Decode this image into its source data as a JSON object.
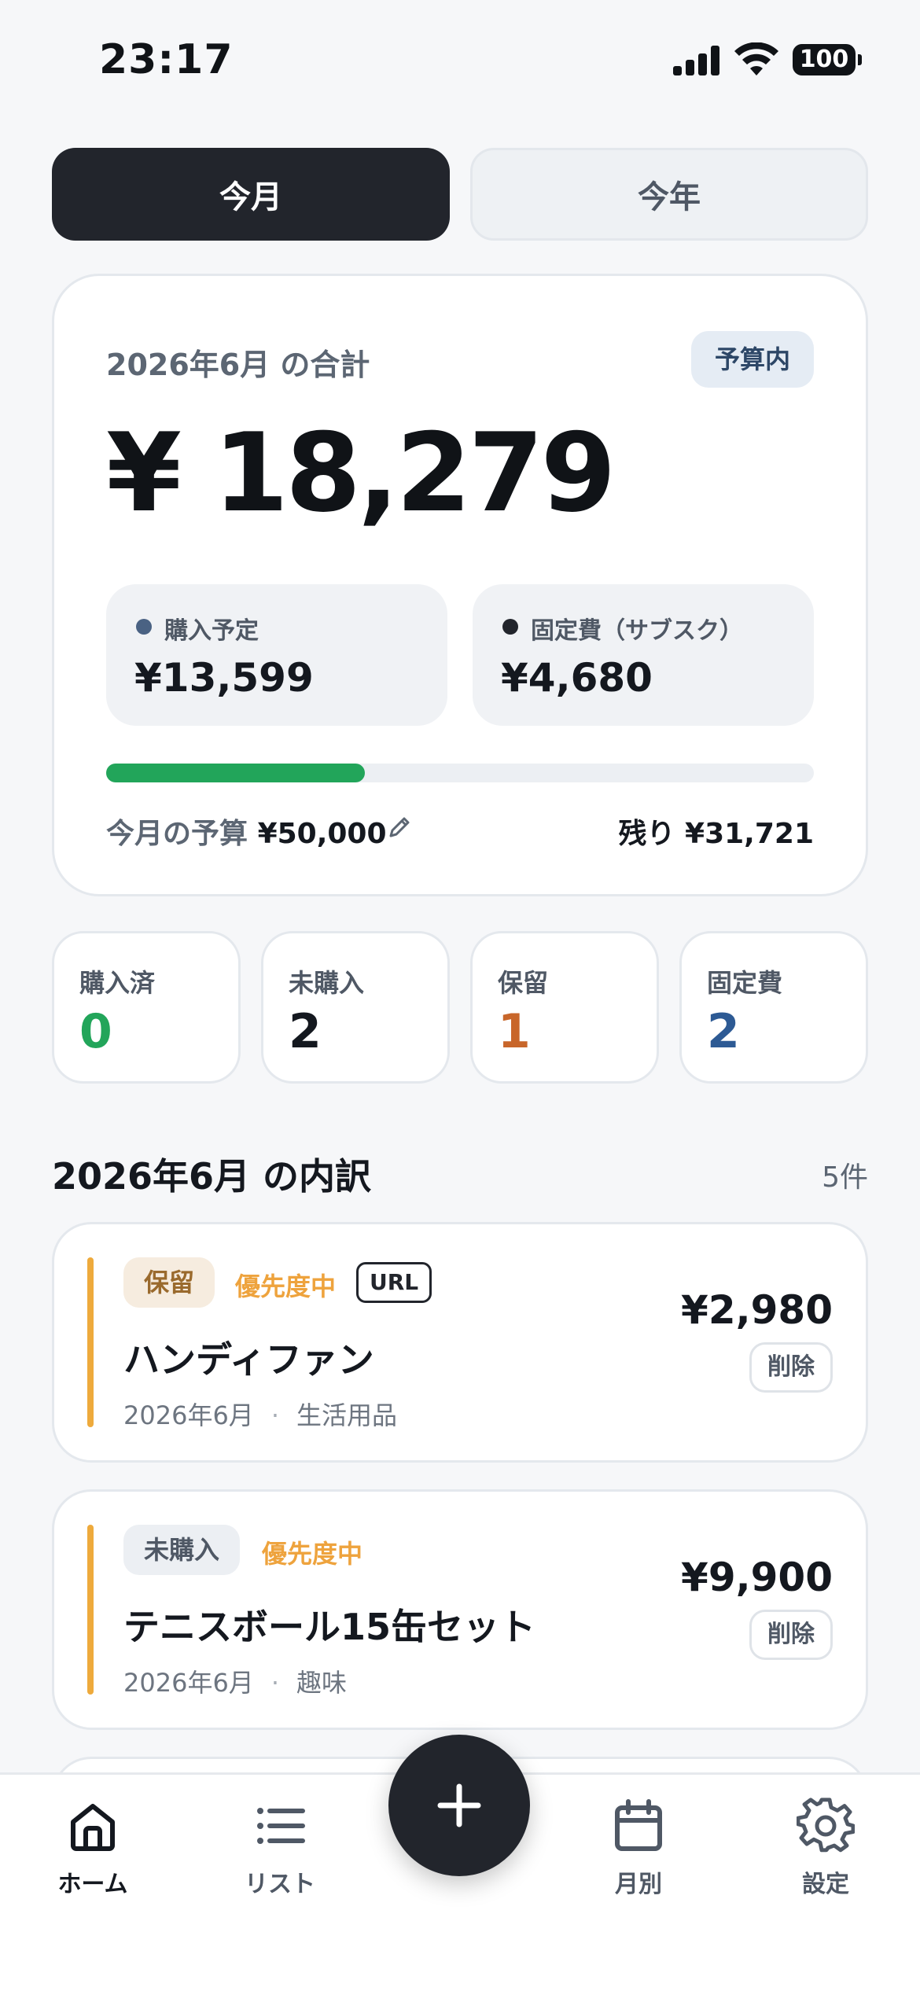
{
  "status_bar": {
    "time": "23:17",
    "battery": "100"
  },
  "segment": {
    "month": "今月",
    "year": "今年"
  },
  "summary": {
    "label": "2026年6月 の合計",
    "badge": "予算内",
    "total": "¥ 18,279",
    "planned": {
      "label": "購入予定",
      "value": "¥13,599",
      "dot_color": "#4a6283"
    },
    "fixed": {
      "label": "固定費（サブスク）",
      "value": "¥4,680",
      "dot_color": "#22252c"
    },
    "progress_fraction": 0.366,
    "progress_color": "#22a55a",
    "budget_label": "今月の予算",
    "budget_value": "¥50,000",
    "remaining": "残り ¥31,721"
  },
  "stats": [
    {
      "label": "購入済",
      "value": "0",
      "color": "#22a55a"
    },
    {
      "label": "未購入",
      "value": "2",
      "color": "#14181f"
    },
    {
      "label": "保留",
      "value": "1",
      "color": "#c8662a"
    },
    {
      "label": "固定費",
      "value": "2",
      "color": "#2d5a94"
    }
  ],
  "breakdown": {
    "title": "2026年6月 の内訳",
    "count": "5件",
    "items": [
      {
        "status": "保留",
        "priority": "優先度中",
        "url_tag": "URL",
        "name": "ハンディファン",
        "month": "2026年6月",
        "category": "生活用品",
        "price": "¥2,980",
        "delete_label": "削除"
      },
      {
        "status": "未購入",
        "priority": "優先度中",
        "name": "テニスボール15缶セット",
        "month": "2026年6月",
        "category": "趣味",
        "price": "¥9,900",
        "delete_label": "削除"
      }
    ]
  },
  "tabbar": {
    "home": "ホーム",
    "list": "リスト",
    "monthly": "月別",
    "settings": "設定"
  },
  "meta_separator": "·",
  "accent_color": "#22252c"
}
